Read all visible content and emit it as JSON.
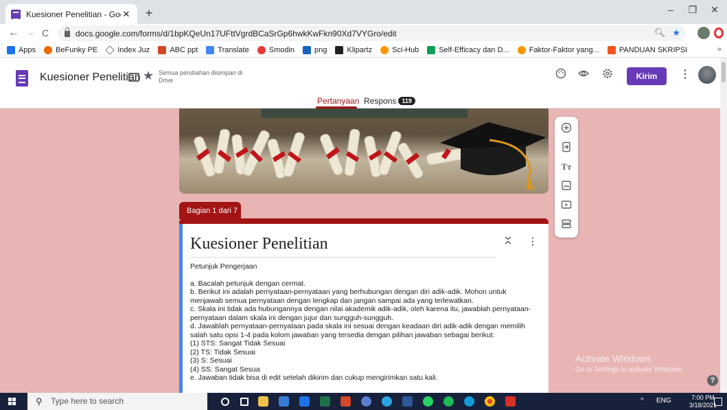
{
  "browser": {
    "tab_title": "Kuesioner Penelitian - Google Fo",
    "tab_close": "✕",
    "new_tab": "+",
    "url": "docs.google.com/forms/d/1bpKQeUn17UFttVgrdBCaSrGp6hwkKwFkn90Xd7VYGro/edit",
    "nav": {
      "back": "←",
      "forward": "→",
      "reload": "C"
    },
    "window": {
      "minimize": "–",
      "maximize": "❐",
      "close": "✕"
    }
  },
  "bookmarks": {
    "items": [
      {
        "label": "Apps",
        "color": "#1a73e8"
      },
      {
        "label": "BeFunky PE",
        "color": "#f06a00"
      },
      {
        "label": "Index Juz",
        "color": "#ffffff"
      },
      {
        "label": "ABC ppt",
        "color": "#d24726"
      },
      {
        "label": "Translate",
        "color": "#4285f4"
      },
      {
        "label": "Smodin",
        "color": "#e53935"
      },
      {
        "label": "png",
        "color": "#1565c0"
      },
      {
        "label": "Klipartz",
        "color": "#222222"
      },
      {
        "label": "Sci-Hub",
        "color": "#ff9800"
      },
      {
        "label": "Self-Efficacy dan D...",
        "color": "#0f9d58"
      },
      {
        "label": "Faktor-Faktor yang...",
        "color": "#f29900"
      },
      {
        "label": "PANDUAN SKRIPSI",
        "color": "#f4511e"
      }
    ],
    "more": "»"
  },
  "form_header": {
    "form_name": "Kuesioner Penelitian",
    "save_status": "Semua perubahan disimpan di Drive",
    "send_label": "Kirim",
    "tabs": [
      {
        "label": "Pertanyaan"
      },
      {
        "label": "Respons"
      }
    ],
    "response_count": "119"
  },
  "section": {
    "tab_label": "Bagian 1 dari 7",
    "title": "Kuesioner Penelitian",
    "heading": "Petunjuk Pengerjaan",
    "lines": [
      "a. Bacalah petunjuk dengan cermat.",
      "b. Berikut ini adalah pernyataan-pernyataan yang berhubungan dengan diri adik-adik. Mohon untuk menjawab semua pernyataan dengan lengkap dan jangan sampai ada yang terlewatkan.",
      "c. Skala ini tidak ada hubungannya dengan nilai akademik adik-adik, oleh karena itu, jawablah pernyataan-pernyataan dalam skala ini dengan jujur dan sungguh-sungguh.",
      "d. Jawablah pernyataan-pernyataan pada skala ini sesuai dengan keadaan diri adik-adik dengan memilih salah satu opsi 1-4 pada kolom jawaban yang tersedia dengan pilihan jawaban sebagai berikut:",
      "(1) STS: Sangat Tidak Sesuai",
      "(2) TS: Tidak Sesuai",
      "(3) S: Sesuai",
      "(4) SS: Sangat Sesua",
      "e. Jawaban tidak bisa di edit setelah dikirim dan cukup mengirimkan satu kali."
    ]
  },
  "watermark": {
    "line1": "Activate Windows",
    "line2": "Go to Settings to activate Windows."
  },
  "taskbar": {
    "search_placeholder": "Type here to search",
    "lang": "ENG",
    "time": "7:00 PM",
    "date": "3/18/2021"
  }
}
